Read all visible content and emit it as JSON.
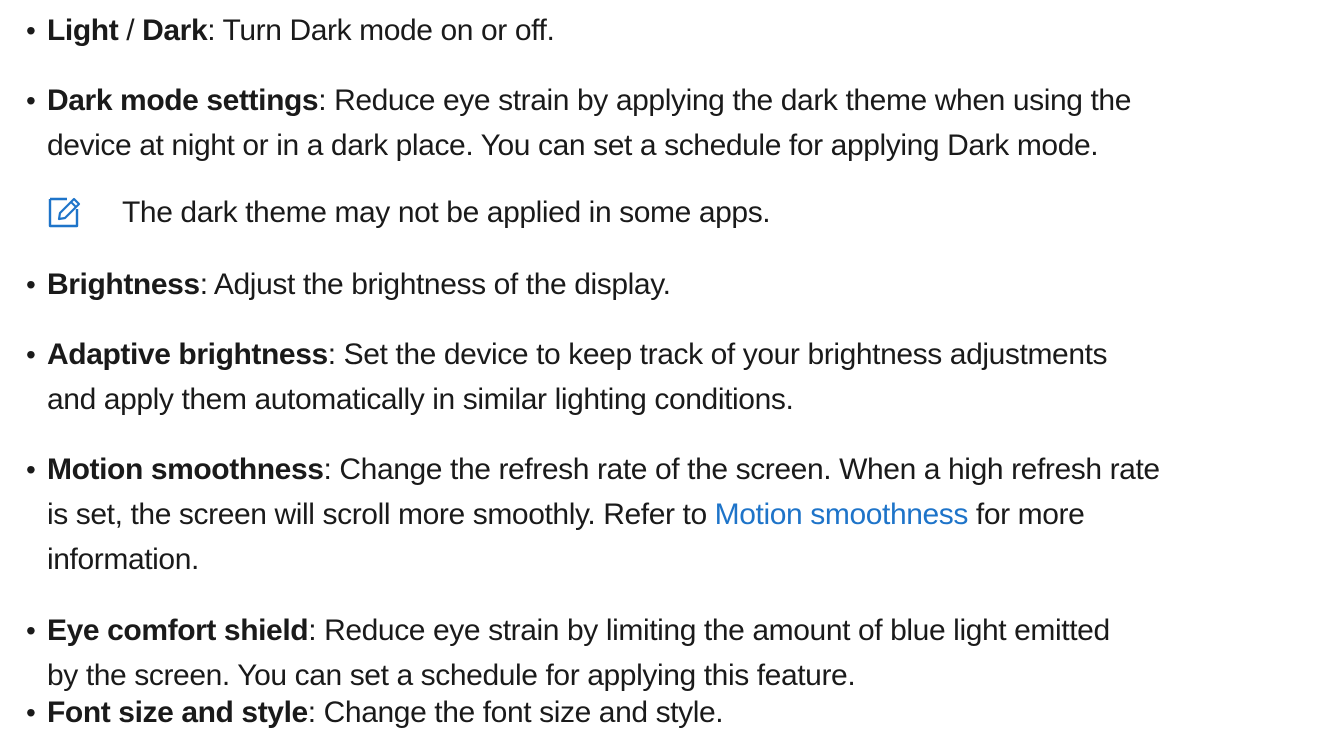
{
  "items": [
    {
      "parts": [
        "Light",
        " / ",
        "Dark",
        ": Turn Dark mode on or off."
      ]
    },
    {
      "term": "Dark mode settings",
      "lines": [
        ": Reduce eye strain by applying the dark theme when using the",
        "device at night or in a dark place. You can set a schedule for applying Dark mode."
      ]
    },
    {
      "term": "Brightness",
      "lines": [
        ": Adjust the brightness of the display."
      ]
    },
    {
      "term": "Adaptive brightness",
      "lines": [
        ": Set the device to keep track of your brightness adjustments",
        "and apply them automatically in similar lighting conditions."
      ]
    },
    {
      "term": "Motion smoothness",
      "lines": [
        ": Change the refresh rate of the screen. When a high refresh rate",
        "is set, the screen will scroll more smoothly. Refer to "
      ],
      "link": "Motion smoothness",
      "after_link": " for more",
      "last_line": "information."
    },
    {
      "term": "Eye comfort shield",
      "lines": [
        ": Reduce eye strain by limiting the amount of blue light emitted",
        "by the screen. You can set a schedule for applying this feature."
      ]
    },
    {
      "term": "Font size and style",
      "lines": [
        ": Change the font size and style."
      ]
    }
  ],
  "note": {
    "icon": "note-pencil-icon",
    "text": "The dark theme may not be applied in some apps."
  },
  "bullet_char": "•",
  "colors": {
    "text": "#1a1a1a",
    "link": "#1e74c9"
  }
}
